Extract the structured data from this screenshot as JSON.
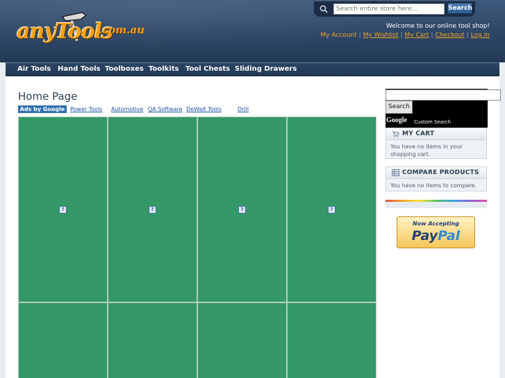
{
  "header": {
    "logo_text": "anyTools",
    "logo_domain": ".com.au",
    "search_placeholder": "Search entire store here...",
    "search_button": "Search",
    "welcome": "Welcome to our online tool shop!",
    "links": [
      "My Account",
      "My Wishlist",
      "My Cart",
      "Checkout",
      "Log In"
    ]
  },
  "nav": {
    "items": [
      "Air Tools",
      "Hand Tools",
      "Toolboxes",
      "Toolkits",
      "Tool Chests",
      "Sliding Drawers"
    ]
  },
  "main": {
    "title": "Home Page",
    "ads_badge": "Ads by Google",
    "ad_links": [
      "Power Tools",
      "Automotive",
      "QA Software",
      "DeWalt Tools",
      "Drill"
    ],
    "placeholder_icon": "?"
  },
  "sidebar": {
    "google_search_button": "Search",
    "google_logo": "Google",
    "google_custom": "Custom Search",
    "cart": {
      "title": "MY CART",
      "body": "You have no items in your shopping cart."
    },
    "compare": {
      "title": "COMPARE PRODUCTS",
      "body": "You have no items to compare."
    },
    "paypal": {
      "accepting": "Now Accepting",
      "logo_pay": "Pay",
      "logo_pal": "Pal"
    }
  },
  "colors": {
    "header_bg": "#2c4564",
    "link_orange": "#f3a62a",
    "placeholder_green": "#349966",
    "ad_link_blue": "#1a4fa0"
  }
}
